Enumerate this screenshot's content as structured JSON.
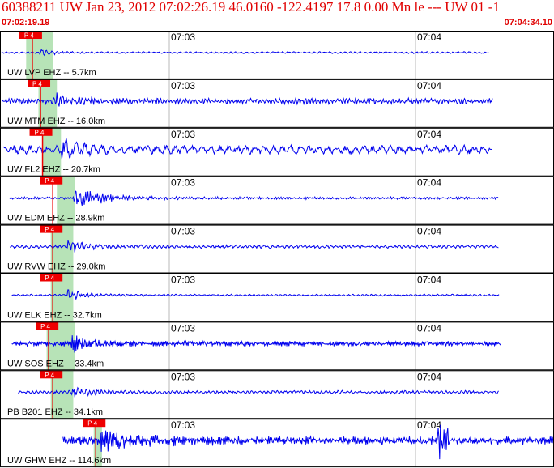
{
  "header": {
    "title": "60388211 UW Jan 23, 2012 07:02:26.19    46.0160 -122.4197 17.8 0.00 Mn le --- UW 01   -1",
    "start_time": "07:02:19.19",
    "end_time": "07:04:34.10"
  },
  "colors": {
    "header_text": "#e00000",
    "trace": "#0000ee",
    "pick_flag": "#ee0000",
    "pick_window": "#9fd99f",
    "frame": "#000000"
  },
  "chart_data": {
    "type": "line",
    "x_label_times": [
      "07:03",
      "07:04"
    ],
    "x_range": [
      "07:02:19.19",
      "07:04:34.10"
    ],
    "grid": true,
    "traces": [
      {
        "label": "UW LVP EHZ -- 5.7km",
        "pick": "P 4",
        "pick_sec": 7.5,
        "window": [
          6.0,
          12.5
        ],
        "trace_start": 0.0,
        "trace_end": 119.0,
        "burst": 9.0,
        "noise": 0.12,
        "burst_amp": 0.45,
        "decay": 3.0,
        "freq": 0.8,
        "spiky": false
      },
      {
        "label": "UW MTM EHZ -- 16.0km",
        "pick": "P 4",
        "pick_sec": 9.5,
        "window": [
          9.0,
          13.5
        ],
        "trace_start": 0.0,
        "trace_end": 120.0,
        "burst": 12.5,
        "noise": 0.35,
        "burst_amp": 1.0,
        "decay": 4.0,
        "freq": 1.3,
        "spiky": false
      },
      {
        "label": "UW FL2 EHZ -- 20.7km",
        "pick": "P 4",
        "pick_sec": 10.0,
        "window": [
          10.0,
          14.5
        ],
        "trace_start": 0.5,
        "trace_end": 120.0,
        "burst": 14.0,
        "noise": 0.55,
        "burst_amp": 1.1,
        "decay": 5.0,
        "freq": 0.45,
        "spiky": false
      },
      {
        "label": "UW EDM EHZ -- 28.9km",
        "pick": "P 4",
        "pick_sec": 12.5,
        "window": [
          13.5,
          18.0
        ],
        "trace_start": 2.0,
        "trace_end": 121.5,
        "burst": 17.5,
        "noise": 0.15,
        "burst_amp": 1.25,
        "decay": 7.0,
        "freq": 1.6,
        "spiky": false
      },
      {
        "label": "UW RVW EHZ -- 29.0km",
        "pick": "P 4",
        "pick_sec": 12.5,
        "window": [
          12.0,
          17.5
        ],
        "trace_start": 2.0,
        "trace_end": 121.5,
        "burst": 16.0,
        "noise": 0.2,
        "burst_amp": 0.7,
        "decay": 4.5,
        "freq": 0.9,
        "spiky": false
      },
      {
        "label": "UW ELK EHZ -- 32.7km",
        "pick": "P 4",
        "pick_sec": 12.5,
        "window": [
          12.0,
          17.5
        ],
        "trace_start": 2.5,
        "trace_end": 121.5,
        "burst": 16.0,
        "noise": 0.12,
        "burst_amp": 0.75,
        "decay": 4.0,
        "freq": 0.9,
        "spiky": false
      },
      {
        "label": "UW SOS EHZ -- 33.4km",
        "pick": "P 4",
        "pick_sec": 11.5,
        "window": [
          11.0,
          18.0
        ],
        "trace_start": 2.5,
        "trace_end": 122.0,
        "burst": 17.0,
        "noise": 0.3,
        "burst_amp": 1.0,
        "decay": 5.0,
        "freq": 2.8,
        "spiky": false
      },
      {
        "label": "PB B201 EHZ -- 34.1km",
        "pick": "P 4",
        "pick_sec": 12.5,
        "window": [
          12.0,
          17.5
        ],
        "trace_start": 4.0,
        "trace_end": 121.5,
        "burst": 16.5,
        "noise": 0.2,
        "burst_amp": 0.8,
        "decay": 4.0,
        "freq": 1.0,
        "spiky": false
      },
      {
        "label": "UW GHW EHZ -- 114.6km",
        "pick": "P 4",
        "pick_sec": 23.0,
        "window": [
          22.5,
          24.5
        ],
        "trace_start": 15.0,
        "trace_end": 135.0,
        "burst": 24.0,
        "noise": 0.55,
        "burst_amp": 0.9,
        "decay": 9.0,
        "freq": 3.0,
        "spiky": true
      }
    ]
  }
}
